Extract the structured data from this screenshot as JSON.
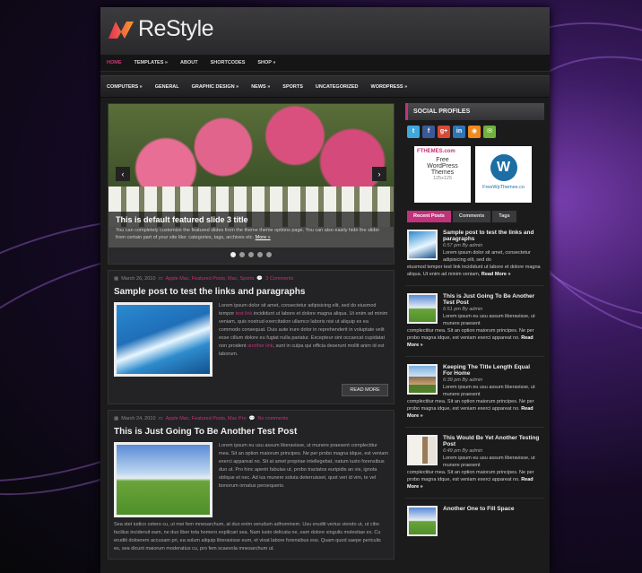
{
  "colors": {
    "accent": "#c0337a",
    "background": "#1b1b1c"
  },
  "logo": {
    "name": "ReStyle"
  },
  "top_nav": [
    {
      "label": "HOME",
      "active": true
    },
    {
      "label": "TEMPLATES »",
      "active": false
    },
    {
      "label": "ABOUT",
      "active": false
    },
    {
      "label": "SHORTCODES",
      "active": false
    },
    {
      "label": "SHOP »",
      "active": false
    }
  ],
  "category_nav": [
    "COMPUTERS »",
    "GENERAL",
    "GRAPHIC DESIGN »",
    "NEWS »",
    "SPORTS",
    "UNCATEGORIZED",
    "WORDPRESS »"
  ],
  "slider": {
    "title": "This is default featured slide 3 title",
    "text": "You can completely customize the featured slides from the theme theme options page. You can also easily hide the slider from certain part of your site like: categories, tags, archives etc.",
    "more": "More »",
    "prev_icon": "chevron-left-icon",
    "next_icon": "chevron-right-icon",
    "dot_count": 5,
    "active_dot": 1
  },
  "posts": [
    {
      "date": "March 26, 2010",
      "categories": "Apple Mac, Featured Posts, Mac, Sports",
      "comments": "3 Comments",
      "title": "Sample post to test the links and paragraphs",
      "p1_a": "Lorem ipsum dolor sit amet, consectetur adipisicing elit, sed do eiusmod tempor ",
      "p1_link": "test link",
      "p1_b": " incididunt ut labore et dolore magna aliqua. Ut enim ad minim veniam, quis nostrud exercitation ullamco laboris nisi ut aliquip ex ea commodo consequat. Duis aute irure dolor in reprehenderit in voluptate velit esse cillum dolore eu fugiat nulla pariatur. Excepteur sint occaecat cupidatat non proident ",
      "p1_link2": "another link",
      "p1_c": ", sunt in culpa qui officia deserunt mollit anim id est laborum.",
      "readmore": "READ MORE"
    },
    {
      "date": "March 24, 2010",
      "categories": "Apple Mac, Featured Posts, Mac Pro",
      "comments": "No comments",
      "title": "This is Just Going To Be Another Test Post",
      "p1": "Lorem ipsum eu usu assum liberavisse, ut munere praesent complectitur mea. Sit an option maiorum principes. Ne per probo magna idque, est veniam exerci appareat no. Sit at amet propriae intellegebat, natum iusto forensibus duo ut. Pro hinc aperiri fabulas ut, probo tractatos euripidis an vis, ignota oblique et nec. Ad ius munere soluta deterruisset, quot veri id vim, te vel bonorum ornatus persequeris.",
      "p2": "Sea stet iudico cetero cu, ut mei fem mnesarchum, at duo enim verudum adhominem. Usu eruditi verius viendo ut, ut cibo facilius incideruit eam, ne duo liber tota homero expilicari sea. Nam iusto delicata ne, eam dolore singulis molestiae ex. Cu eruditi doloerem accusam pri, ea solum aliquip liberavisse eum, et vixat labore forensibus eos. Quam quod saepe periculis es, sea dicunt maiorum moderatius cu, pro fem scaevola mnesarchum ut."
    }
  ],
  "sidebar": {
    "social_title": "SOCIAL PROFILES",
    "socials": [
      {
        "icon": "twitter-icon",
        "label": "t",
        "color": "#3fa9dd"
      },
      {
        "icon": "facebook-icon",
        "label": "f",
        "color": "#3b5998"
      },
      {
        "icon": "google-plus-icon",
        "label": "g+",
        "color": "#d64a36"
      },
      {
        "icon": "linkedin-icon",
        "label": "in",
        "color": "#2f74b3"
      },
      {
        "icon": "rss-icon",
        "label": "◉",
        "color": "#f08a1e"
      },
      {
        "icon": "email-icon",
        "label": "✉",
        "color": "#6fb23c"
      }
    ],
    "ad1": {
      "brand": "FTHEMES.com",
      "line1": "Free",
      "line2": "WordPress",
      "line3": "Themes",
      "size": "125x125"
    },
    "ad2": {
      "brand": "FreeWpThemes.co"
    },
    "tabs": [
      {
        "label": "Recent Posts",
        "active": true
      },
      {
        "label": "Comments",
        "active": false
      },
      {
        "label": "Tags",
        "active": false
      }
    ],
    "recent": [
      {
        "title": "Sample post to test the links and paragraphs",
        "date": "6:57 pm By admin",
        "text": "Lorem ipsum dolor sit amet, consectetur adipisicing elit, sed do",
        "excerpt": "eiusmod tempor test link incididunt ut labore et dolore magna aliqua. Ut enim ad minim veniam,",
        "more": "Read More »",
        "thumb": "surf"
      },
      {
        "title": "This is Just Going To Be Another Test Post",
        "date": "6:51 pm By admin",
        "text": "Lorem ipsum eu usu assum liberavisse, ut munere praesent",
        "excerpt": "complectitur mea. Sit an option maiorum principes. Ne per probo magna idque, est veniam exerci appareat no.",
        "more": "Read More »",
        "thumb": "field"
      },
      {
        "title": "Keeping The Title Length Equal For Home",
        "date": "6:39 pm By admin",
        "text": "Lorem ipsum eu usu assum liberavisse, ut munere praesent",
        "excerpt": "complectitur mea. Sit an option maiorum principes. Ne per probo magna idque, est veniam exerci appareat no.",
        "more": "Read More »",
        "thumb": "house"
      },
      {
        "title": "This Would Be Yet Another Testing Post",
        "date": "6:49 pm By admin",
        "text": "Lorem ipsum eu usu assum liberavisse, ut munere praesent",
        "excerpt": "complectitur mea. Sit an option maiorum principes. Ne per probo magna idque, est veniam exerci appareat no.",
        "more": "Read More »",
        "thumb": "room"
      },
      {
        "title": "Another One to Fill Space",
        "thumb": "field"
      }
    ]
  }
}
